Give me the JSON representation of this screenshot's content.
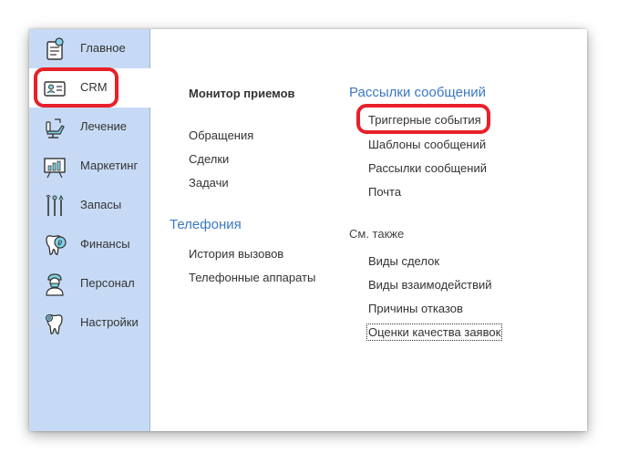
{
  "sidebar": {
    "items": [
      {
        "label": "Главное",
        "icon": "home-doc-icon"
      },
      {
        "label": "CRM",
        "icon": "crm-card-icon"
      },
      {
        "label": "Лечение",
        "icon": "dental-chair-icon"
      },
      {
        "label": "Маркетинг",
        "icon": "presentation-board-icon"
      },
      {
        "label": "Запасы",
        "icon": "dental-tools-icon"
      },
      {
        "label": "Финансы",
        "icon": "tooth-coin-icon"
      },
      {
        "label": "Персонал",
        "icon": "doctor-icon"
      },
      {
        "label": "Настройки",
        "icon": "tooth-settings-icon"
      }
    ],
    "active": "CRM"
  },
  "content": {
    "monitor": "Монитор приемов",
    "crm_links": [
      "Обращения",
      "Сделки",
      "Задачи"
    ],
    "telephony": {
      "title": "Телефония",
      "links": [
        "История вызовов",
        "Телефонные аппараты"
      ]
    },
    "mailings": {
      "title": "Рассылки сообщений",
      "links": [
        "Триггерные события",
        "Шаблоны сообщений",
        "Рассылки сообщений",
        "Почта"
      ]
    },
    "see_also": {
      "title": "См. также",
      "links": [
        "Виды сделок",
        "Виды взаимодействий",
        "Причины отказов",
        "Оценки качества заявок"
      ]
    }
  },
  "colors": {
    "sidebar_bg": "#c7daf5",
    "accent_blue": "#3b78c4",
    "highlight_red": "#e8202a"
  }
}
